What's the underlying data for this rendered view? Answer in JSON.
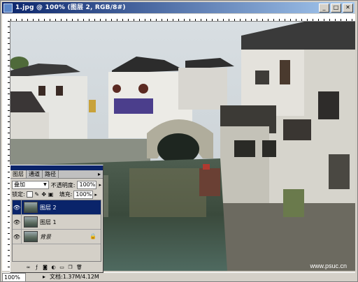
{
  "window": {
    "title": "1.jpg @ 100% (图层 2, RGB/8#)",
    "buttons": {
      "minimize": "_",
      "maximize": "□",
      "close": "✕"
    }
  },
  "canvas": {
    "watermark": "www.psuc.cn"
  },
  "status": {
    "zoom": "100%",
    "doc": "文档:1.37M/4.12M",
    "arrow": "▸"
  },
  "layers_panel": {
    "tabs": [
      "图层",
      "通道",
      "路径"
    ],
    "menu_icon": "▸",
    "blend_mode": "叠加",
    "opacity_label": "不透明度:",
    "opacity_value": "100%",
    "lock_label": "锁定:",
    "fill_label": "填充:",
    "fill_value": "100%",
    "layers": [
      {
        "name": "图层 2",
        "selected": true
      },
      {
        "name": "图层 1",
        "selected": false
      },
      {
        "name": "背景",
        "selected": false,
        "locked": true
      }
    ],
    "eye_glyph": "👁",
    "lock_glyph": "🔒"
  },
  "colors": {
    "titlebar_start": "#0a246a",
    "titlebar_end": "#a6caf0",
    "selected_layer": "#0a246a",
    "panel_bg": "#d4d0c8"
  }
}
